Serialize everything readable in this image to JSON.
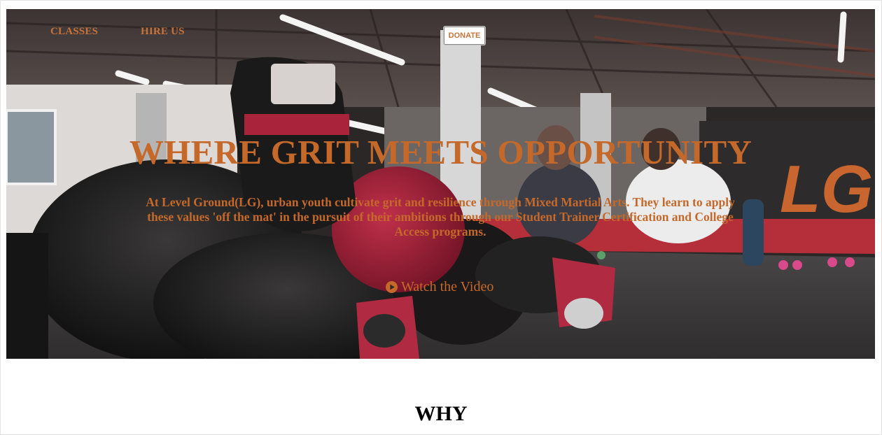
{
  "nav": {
    "classes_label": "CLASSES",
    "hire_label": "HIRE US",
    "donate_label": "DONATE"
  },
  "hero": {
    "title": "WHERE GRIT MEETS OPPORTUNITY",
    "description": "At Level Ground(LG), urban youth cultivate grit and resilience through Mixed Martial Arts. They learn to apply these values 'off the mat' in the pursuit of their ambitions through our Student Trainer Certification and College Access programs.",
    "watch_label": "Watch the Video",
    "wall_logo": "LG"
  },
  "section": {
    "why_heading": "WHY"
  },
  "colors": {
    "accent": "#c5692b",
    "heading": "#000000"
  }
}
